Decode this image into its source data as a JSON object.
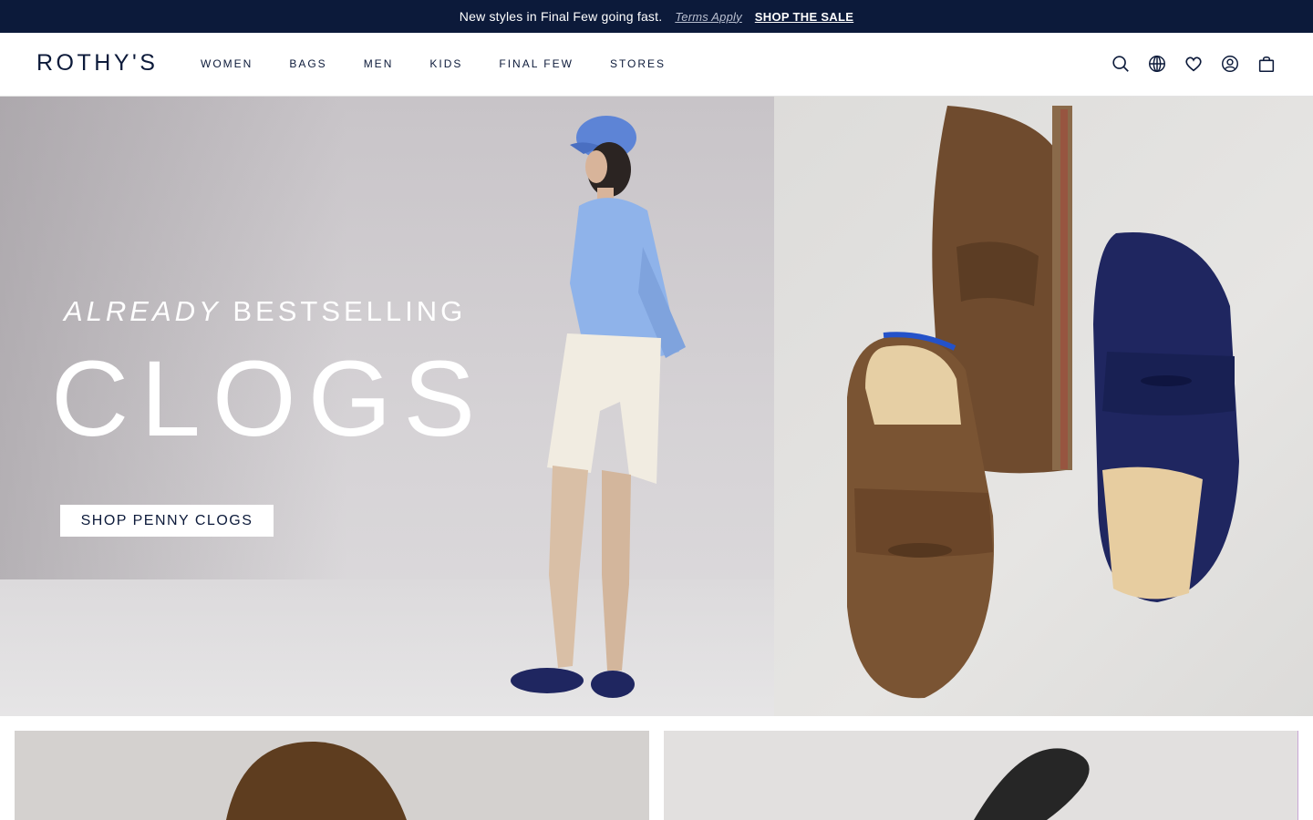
{
  "announcement": {
    "message": "New styles in Final Few going fast.",
    "terms_link": "Terms Apply",
    "cta_link": "SHOP THE SALE"
  },
  "header": {
    "logo": "ROTHY'S",
    "nav": [
      "WOMEN",
      "BAGS",
      "MEN",
      "KIDS",
      "FINAL FEW",
      "STORES"
    ],
    "icons": [
      "search-icon",
      "globe-icon",
      "heart-icon",
      "account-icon",
      "bag-icon"
    ]
  },
  "hero": {
    "eyebrow_italic": "ALREADY",
    "eyebrow_rest": "BESTSELLING",
    "headline": "CLOGS",
    "cta": "SHOP PENNY CLOGS"
  },
  "colors": {
    "brand_navy": "#0c1a3a",
    "white": "#ffffff",
    "clog_brown": "#7a5433",
    "clog_navy": "#1f2660",
    "shirt_blue": "#8fb3ea"
  }
}
